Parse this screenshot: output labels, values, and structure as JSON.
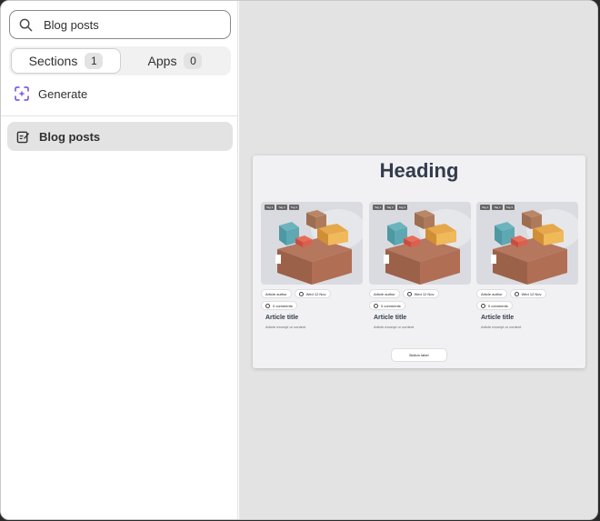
{
  "search": {
    "value": "Blog posts",
    "icon": "search-icon"
  },
  "tabs": [
    {
      "label": "Sections",
      "count": "1"
    },
    {
      "label": "Apps",
      "count": "0"
    }
  ],
  "generate": {
    "label": "Generate"
  },
  "results": [
    {
      "label": "Blog posts"
    }
  ],
  "preview": {
    "heading": "Heading",
    "posts": [
      {
        "tags": [
          "Tag 1",
          "Tag 2",
          "Tag 3"
        ],
        "author": "Article author",
        "date": "Wed 12 Nov",
        "comments": "0 comments",
        "title": "Article title",
        "excerpt": "Article excerpt or content"
      },
      {
        "tags": [
          "Tag 1",
          "Tag 2",
          "Tag 3"
        ],
        "author": "Article author",
        "date": "Wed 12 Nov",
        "comments": "0 comments",
        "title": "Article title",
        "excerpt": "Article excerpt or content"
      },
      {
        "tags": [
          "Tag 1",
          "Tag 2",
          "Tag 3"
        ],
        "author": "Article author",
        "date": "Wed 12 Nov",
        "comments": "0 comments",
        "title": "Article title",
        "excerpt": "Article excerpt or content"
      }
    ],
    "button": "Button label"
  },
  "colors": {
    "accent": "#8a5cf6",
    "selected_bg": "#e3e3e3",
    "heading": "#333c4c"
  }
}
